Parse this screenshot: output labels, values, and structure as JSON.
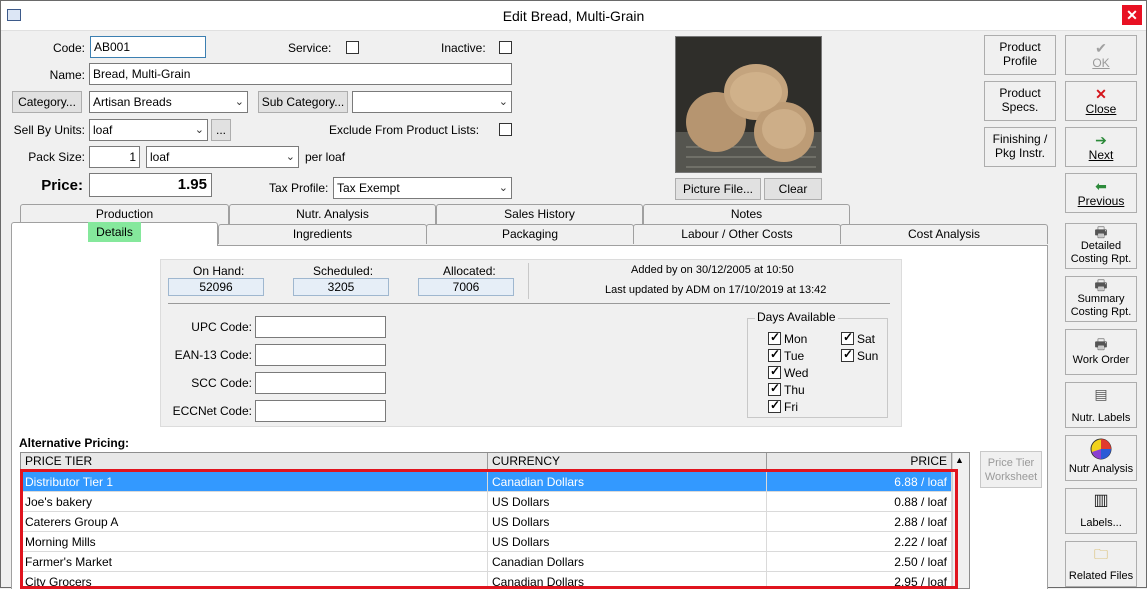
{
  "window": {
    "title": "Edit Bread, Multi-Grain",
    "close_glyph": "✕"
  },
  "form": {
    "code_label": "Code:",
    "code_value": "AB001",
    "service_label": "Service:",
    "inactive_label": "Inactive:",
    "name_label": "Name:",
    "name_value": "Bread, Multi-Grain",
    "category_button": "Category...",
    "category_value": "Artisan Breads",
    "subcategory_button": "Sub Category...",
    "subcategory_value": "",
    "sell_by_label": "Sell By Units:",
    "sell_by_value": "loaf",
    "sell_by_more": "...",
    "exclude_label": "Exclude From Product Lists:",
    "pack_size_label": "Pack Size:",
    "pack_size_value": "1",
    "pack_unit_value": "loaf",
    "per_loaf": "per loaf",
    "price_label": "Price:",
    "price_value": "1.95",
    "tax_profile_label": "Tax Profile:",
    "tax_profile_value": "Tax Exempt",
    "picture_button": "Picture File...",
    "clear_button": "Clear"
  },
  "actions": {
    "product_profile": [
      "Product",
      "Profile"
    ],
    "ok": "OK",
    "product_specs": [
      "Product",
      "Specs."
    ],
    "close": "Close",
    "finishing": [
      "Finishing /",
      "Pkg Instr."
    ],
    "next": "Next",
    "previous": "Previous",
    "detailed_costing": [
      "Detailed",
      "Costing Rpt."
    ],
    "summary_costing": [
      "Summary",
      "Costing Rpt."
    ],
    "work_order": "Work Order",
    "nutr_labels": "Nutr. Labels",
    "nutr_analysis": "Nutr Analysis",
    "labels": "Labels...",
    "related_files": "Related Files"
  },
  "tabs_back": [
    "Production",
    "Nutr. Analysis",
    "Sales History",
    "Notes"
  ],
  "tabs_front": [
    "Details",
    "Ingredients",
    "Packaging",
    "Labour / Other Costs",
    "Cost Analysis"
  ],
  "stats": {
    "on_hand_label": "On Hand:",
    "on_hand_value": "52096",
    "scheduled_label": "Scheduled:",
    "scheduled_value": "3205",
    "allocated_label": "Allocated:",
    "allocated_value": "7006",
    "added_by": "Added by  on 30/12/2005 at 10:50",
    "updated_by": "Last updated by ADM on 17/10/2019 at 13:42"
  },
  "codes": {
    "upc_label": "UPC Code:",
    "ean_label": "EAN-13 Code:",
    "scc_label": "SCC Code:",
    "eccnet_label": "ECCNet Code:"
  },
  "days": {
    "title": "Days Available",
    "mon": "Mon",
    "tue": "Tue",
    "wed": "Wed",
    "thu": "Thu",
    "fri": "Fri",
    "sat": "Sat",
    "sun": "Sun"
  },
  "alt_pricing": {
    "title": "Alternative Pricing:",
    "headers": [
      "PRICE TIER",
      "CURRENCY",
      "PRICE"
    ],
    "rows": [
      [
        "Distributor Tier 1",
        "Canadian Dollars",
        "6.88 / loaf"
      ],
      [
        "Joe's bakery",
        "US Dollars",
        "0.88 / loaf"
      ],
      [
        "Caterers Group A",
        "US Dollars",
        "2.88 / loaf"
      ],
      [
        "Morning Mills",
        "US Dollars",
        "2.22 / loaf"
      ],
      [
        "Farmer's Market",
        "Canadian Dollars",
        "2.50 / loaf"
      ],
      [
        "City Grocers",
        "Canadian Dollars",
        "2.95 / loaf"
      ]
    ],
    "worksheet_button": [
      "Price Tier",
      "Worksheet"
    ]
  },
  "colors": {
    "selection": "#3399ff",
    "highlight_tab": "#85e89c",
    "annotation": "#e0141e"
  }
}
